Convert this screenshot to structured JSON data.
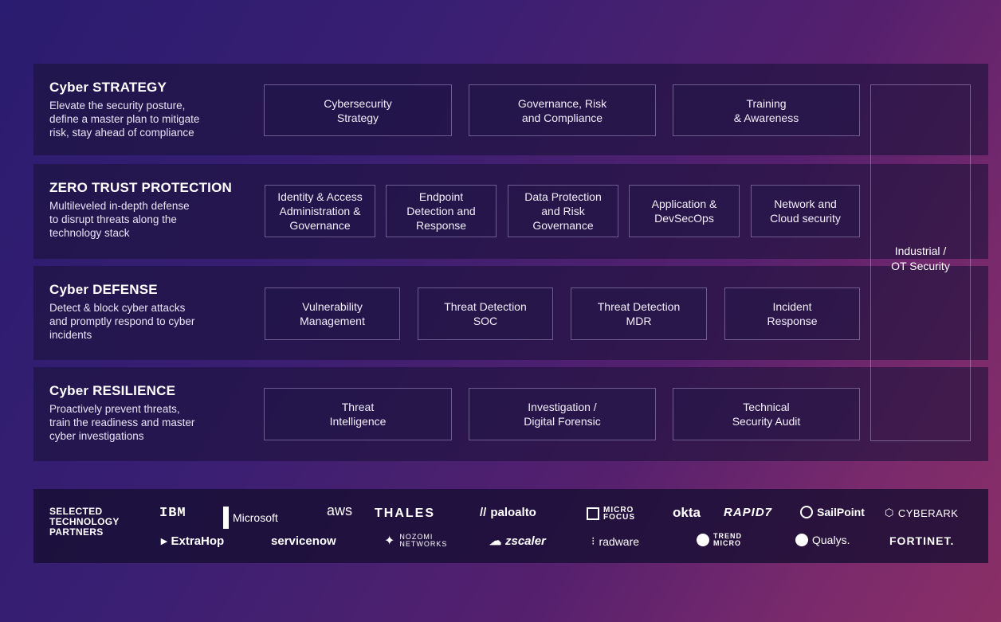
{
  "sections": [
    {
      "title": "Cyber STRATEGY",
      "description": "Elevate the security posture,\ndefine a master plan to mitigate\nrisk, stay ahead of compliance",
      "boxes": [
        "Cybersecurity\nStrategy",
        "Governance, Risk\nand Compliance",
        "Training\n& Awareness"
      ]
    },
    {
      "title": "ZERO TRUST PROTECTION",
      "description": "Multileveled in-depth defense\nto disrupt threats along the\ntechnology stack",
      "boxes": [
        "Identity & Access\nAdministration &\nGovernance",
        "Endpoint\nDetection and\nResponse",
        "Data Protection\nand Risk\nGovernance",
        "Application &\nDevSecOps",
        "Network and\nCloud security"
      ]
    },
    {
      "title": "Cyber DEFENSE",
      "description": "Detect & block cyber attacks\nand promptly respond to cyber\nincidents",
      "boxes": [
        "Vulnerability\nManagement",
        "Threat Detection\nSOC",
        "Threat Detection\nMDR",
        "Incident\nResponse"
      ]
    },
    {
      "title": "Cyber RESILIENCE",
      "description": "Proactively prevent threats,\ntrain the readiness and master\ncyber investigations",
      "boxes": [
        "Threat\nIntelligence",
        "Investigation /\nDigital Forensic",
        "Technical\nSecurity Audit"
      ]
    }
  ],
  "side_box": "Industrial /\nOT Security",
  "partners": {
    "label": "SELECTED\nTECHNOLOGY\nPARTNERS",
    "row1": [
      "IBM",
      "Microsoft",
      "aws",
      "THALES",
      "paloalto",
      "MICRO FOCUS",
      "okta",
      "RAPID7",
      "SailPoint",
      "CYBERARK"
    ],
    "row2": [
      "ExtraHop",
      "servicenow",
      "NOZOMI NETWORKS",
      "zscaler",
      "radware",
      "TREND MICRO",
      "Qualys.",
      "FORTINET."
    ]
  }
}
